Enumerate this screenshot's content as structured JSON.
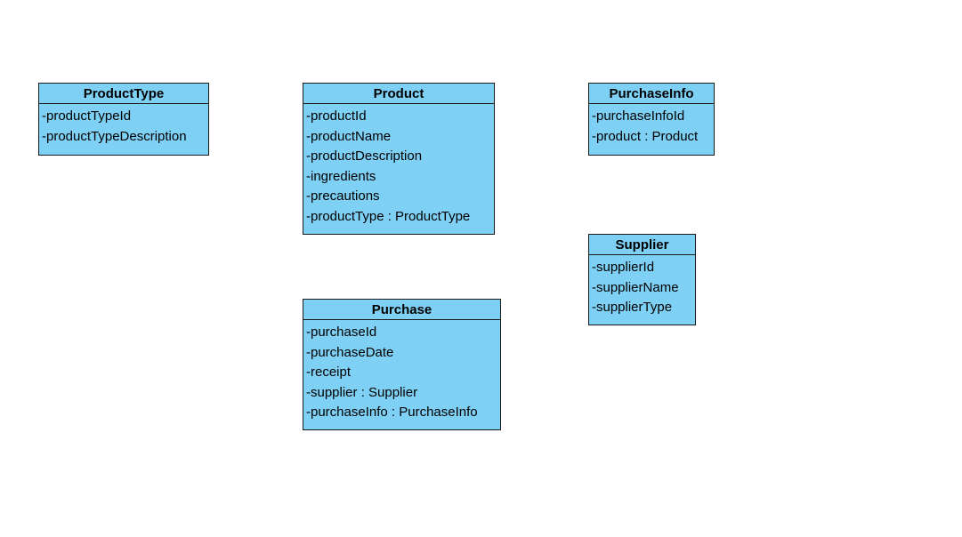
{
  "classes": [
    {
      "id": "producttype",
      "name": "ProductType",
      "attributes": [
        "-productTypeId",
        "-productTypeDescription"
      ]
    },
    {
      "id": "product",
      "name": "Product",
      "attributes": [
        "-productId",
        "-productName",
        "-productDescription",
        "-ingredients",
        "-precautions",
        "-productType : ProductType"
      ]
    },
    {
      "id": "purchaseinfo",
      "name": "PurchaseInfo",
      "attributes": [
        "-purchaseInfoId",
        "-product : Product"
      ]
    },
    {
      "id": "supplier",
      "name": "Supplier",
      "attributes": [
        "-supplierId",
        "-supplierName",
        "-supplierType"
      ]
    },
    {
      "id": "purchase",
      "name": "Purchase",
      "attributes": [
        "-purchaseId",
        "-purchaseDate",
        "-receipt",
        "-supplier : Supplier",
        "-purchaseInfo : PurchaseInfo"
      ]
    }
  ],
  "colors": {
    "class_fill": "#7fd0f5",
    "border": "#1a1a1a"
  }
}
